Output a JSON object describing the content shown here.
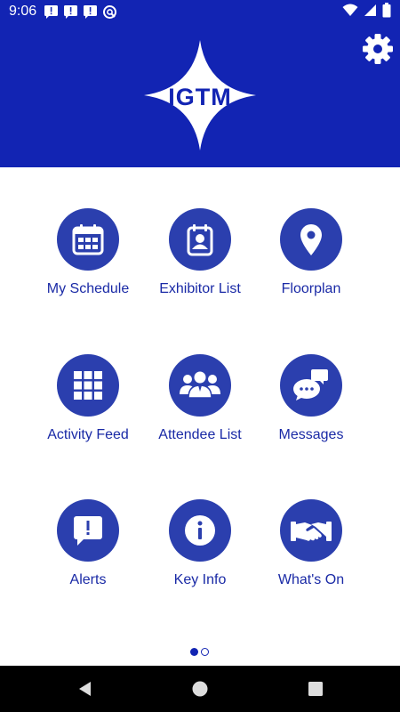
{
  "status_bar": {
    "time": "9:06",
    "notification_icons": [
      "alert-message-icon",
      "alert-message-icon",
      "alert-message-icon",
      "do-not-disturb-icon"
    ],
    "system_icons": [
      "wifi-icon",
      "signal-icon",
      "battery-icon"
    ]
  },
  "header": {
    "logo_text": "IGTM",
    "settings_icon": "gear-icon"
  },
  "menu": [
    {
      "label": "My Schedule",
      "icon": "calendar-icon"
    },
    {
      "label": "Exhibitor List",
      "icon": "contact-card-icon"
    },
    {
      "label": "Floorplan",
      "icon": "map-pin-icon"
    },
    {
      "label": "Activity Feed",
      "icon": "grid-icon"
    },
    {
      "label": "Attendee List",
      "icon": "people-icon"
    },
    {
      "label": "Messages",
      "icon": "chat-bubbles-icon"
    },
    {
      "label": "Alerts",
      "icon": "alert-bubble-icon"
    },
    {
      "label": "Key Info",
      "icon": "info-icon"
    },
    {
      "label": "What's On",
      "icon": "handshake-icon"
    }
  ],
  "pagination": {
    "pages": 2,
    "current": 1
  },
  "nav_bar": [
    "back-icon",
    "home-icon",
    "recents-icon"
  ],
  "colors": {
    "brand": "#1224b3",
    "icon_circle": "#2b3fae",
    "label": "#1a2aa6"
  }
}
